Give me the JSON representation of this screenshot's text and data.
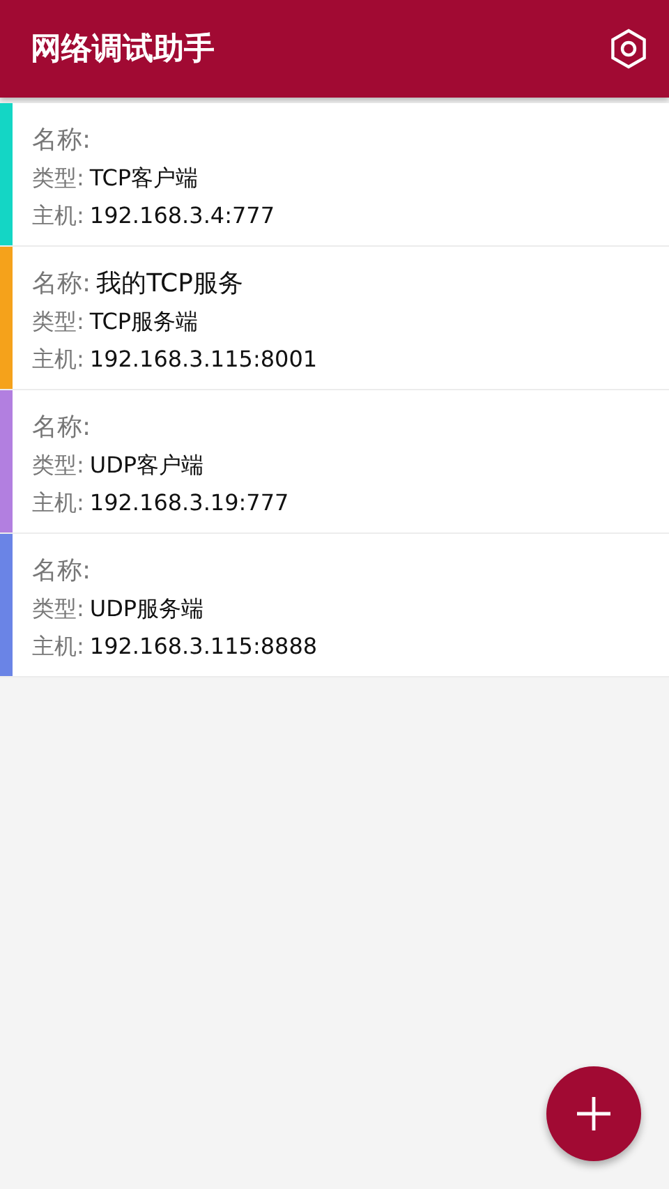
{
  "app_bar": {
    "title": "网络调试助手"
  },
  "connections": [
    {
      "color": "#14d6c5",
      "name_label": "名称:",
      "type_label": "类型:",
      "type": "TCP客户端",
      "host_label": "主机:",
      "host": "192.168.3.4:777"
    },
    {
      "color": "#f5a21b",
      "name_label": "名称:",
      "name": "我的TCP服务",
      "type_label": "类型:",
      "type": "TCP服务端",
      "host_label": "主机:",
      "host": "192.168.3.115:8001"
    },
    {
      "color": "#b27fe0",
      "name_label": "名称:",
      "type_label": "类型:",
      "type": "UDP客户端",
      "host_label": "主机:",
      "host": "192.168.3.19:777"
    },
    {
      "color": "#6a84e6",
      "name_label": "名称:",
      "type_label": "类型:",
      "type": "UDP服务端",
      "host_label": "主机:",
      "host": "192.168.3.115:8888"
    }
  ]
}
